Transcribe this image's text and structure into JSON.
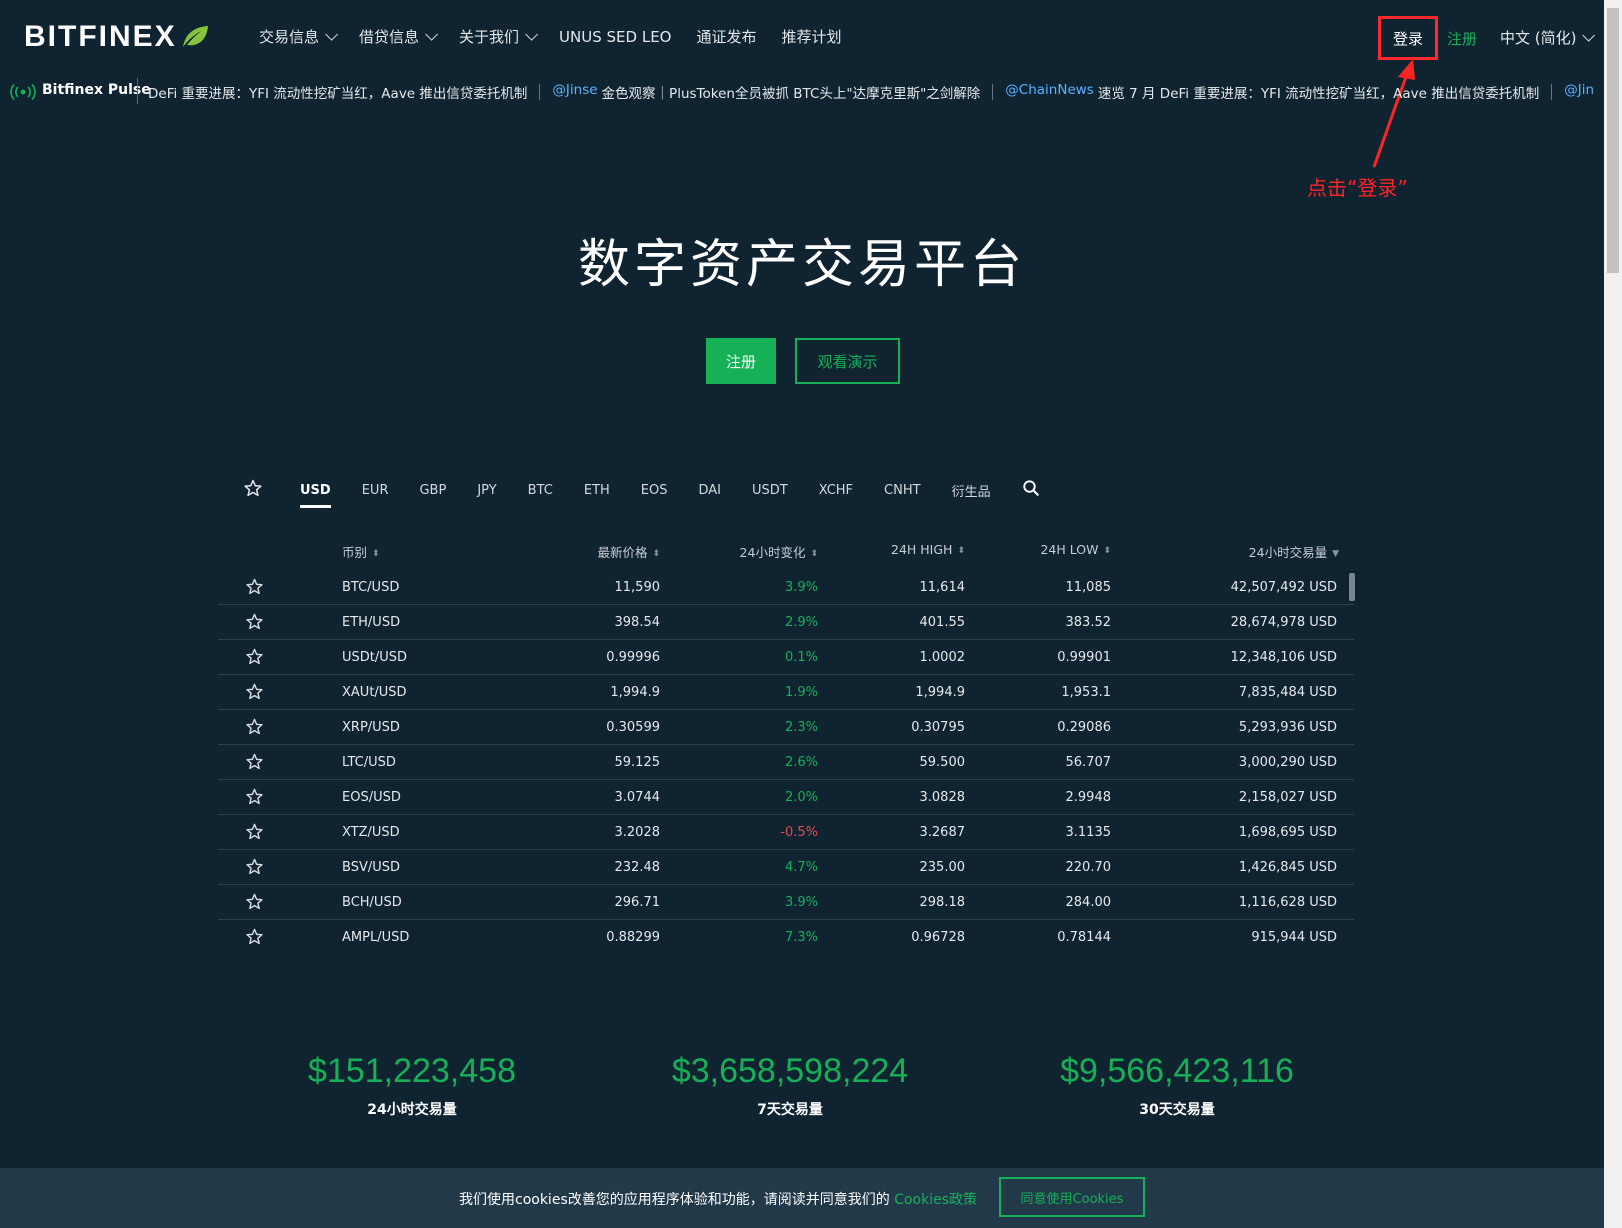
{
  "nav": {
    "logo": "BITFINEX",
    "links": [
      {
        "label": "交易信息",
        "dropdown": true
      },
      {
        "label": "借贷信息",
        "dropdown": true
      },
      {
        "label": "关于我们",
        "dropdown": true
      },
      {
        "label": "UNUS SED LEO",
        "dropdown": false
      },
      {
        "label": "通证发布",
        "dropdown": false
      },
      {
        "label": "推荐计划",
        "dropdown": false
      }
    ],
    "login": "登录",
    "signup": "注册",
    "language": "中文 (简化)"
  },
  "ticker": {
    "title": "Bitfinex Pulse",
    "items": [
      {
        "author": "",
        "text": "DeFi 重要进展：YFI 流动性挖矿当红，Aave 推出信贷委托机制"
      },
      {
        "author": "@Jinse",
        "text": "金色观察｜PlusToken全员被抓 BTC头上\"达摩克里斯\"之剑解除"
      },
      {
        "author": "@ChainNews",
        "text": "速览 7 月 DeFi 重要进展：YFI 流动性挖矿当红，Aave 推出信贷委托机制"
      },
      {
        "author": "@Jin",
        "text": ""
      }
    ]
  },
  "annotation": "点击“登录”",
  "hero": {
    "title": "数字资产交易平台",
    "primary_button": "注册",
    "secondary_button": "观看演示"
  },
  "tabs": [
    "USD",
    "EUR",
    "GBP",
    "JPY",
    "BTC",
    "ETH",
    "EOS",
    "DAI",
    "USDT",
    "XCHF",
    "CNHT",
    "衍生品"
  ],
  "active_tab": "USD",
  "table": {
    "headers": {
      "pair": "币别",
      "last": "最新价格",
      "change": "24小时变化",
      "high": "24H HIGH",
      "low": "24H LOW",
      "volume": "24小时交易量"
    },
    "rows": [
      {
        "pair": "BTC/USD",
        "last": "11,590",
        "change": "3.9%",
        "dir": "pos",
        "high": "11,614",
        "low": "11,085",
        "volume": "42,507,492 USD"
      },
      {
        "pair": "ETH/USD",
        "last": "398.54",
        "change": "2.9%",
        "dir": "pos",
        "high": "401.55",
        "low": "383.52",
        "volume": "28,674,978 USD"
      },
      {
        "pair": "USDt/USD",
        "last": "0.99996",
        "change": "0.1%",
        "dir": "pos",
        "high": "1.0002",
        "low": "0.99901",
        "volume": "12,348,106 USD"
      },
      {
        "pair": "XAUt/USD",
        "last": "1,994.9",
        "change": "1.9%",
        "dir": "pos",
        "high": "1,994.9",
        "low": "1,953.1",
        "volume": "7,835,484 USD"
      },
      {
        "pair": "XRP/USD",
        "last": "0.30599",
        "change": "2.3%",
        "dir": "pos",
        "high": "0.30795",
        "low": "0.29086",
        "volume": "5,293,936 USD"
      },
      {
        "pair": "LTC/USD",
        "last": "59.125",
        "change": "2.6%",
        "dir": "pos",
        "high": "59.500",
        "low": "56.707",
        "volume": "3,000,290 USD"
      },
      {
        "pair": "EOS/USD",
        "last": "3.0744",
        "change": "2.0%",
        "dir": "pos",
        "high": "3.0828",
        "low": "2.9948",
        "volume": "2,158,027 USD"
      },
      {
        "pair": "XTZ/USD",
        "last": "3.2028",
        "change": "-0.5%",
        "dir": "neg",
        "high": "3.2687",
        "low": "3.1135",
        "volume": "1,698,695 USD"
      },
      {
        "pair": "BSV/USD",
        "last": "232.48",
        "change": "4.7%",
        "dir": "pos",
        "high": "235.00",
        "low": "220.70",
        "volume": "1,426,845 USD"
      },
      {
        "pair": "BCH/USD",
        "last": "296.71",
        "change": "3.9%",
        "dir": "pos",
        "high": "298.18",
        "low": "284.00",
        "volume": "1,116,628 USD"
      },
      {
        "pair": "AMPL/USD",
        "last": "0.88299",
        "change": "7.3%",
        "dir": "pos",
        "high": "0.96728",
        "low": "0.78144",
        "volume": "915,944 USD"
      }
    ]
  },
  "stats": [
    {
      "value": "$151,223,458",
      "label": "24小时交易量"
    },
    {
      "value": "$3,658,598,224",
      "label": "7天交易量"
    },
    {
      "value": "$9,566,423,116",
      "label": "30天交易量"
    }
  ],
  "cookie": {
    "text": "我们使用cookies改善您的应用程序体验和功能，请阅读并同意我们的",
    "link": "Cookies政策",
    "button": "同意使用Cookies"
  },
  "colors": {
    "background": "#102331",
    "accent": "#16b157",
    "negative": "#e44b44",
    "annotation": "#ff2424"
  }
}
